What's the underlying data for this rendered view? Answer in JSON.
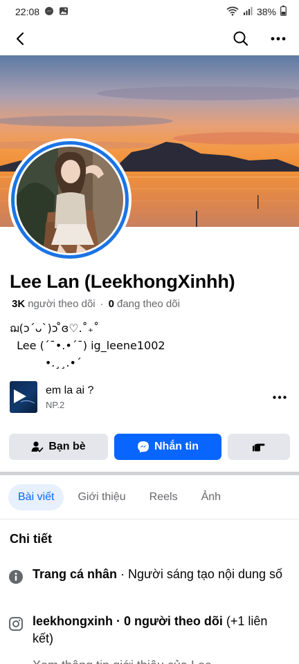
{
  "status": {
    "time": "22:08",
    "battery": "38%"
  },
  "profile": {
    "name": "Lee Lan (LeekhongXinhh)",
    "followers_count": "3K",
    "followers_label": "người theo dõi",
    "separator": "·",
    "following_count": "0",
    "following_label": "đang theo dõi"
  },
  "bio": {
    "line1": "ฌ(ɔ´ᴗ`)ɔ ̊ɞ♡.˚₊˚",
    "line2": "  Lee (´¯•.•´¯) ig_leene1002",
    "line3": "          •.¸¸.•´"
  },
  "music": {
    "title": "em la ai ?",
    "artist": "NP.2"
  },
  "actions": {
    "friends_label": "Bạn bè",
    "message_label": "Nhắn tin"
  },
  "tabs": [
    {
      "label": "Bài viết",
      "active": true
    },
    {
      "label": "Giới thiệu",
      "active": false
    },
    {
      "label": "Reels",
      "active": false
    },
    {
      "label": "Ảnh",
      "active": false
    }
  ],
  "details": {
    "title": "Chi tiết",
    "page_bold": "Trang cá nhân",
    "page_rest": " · Người sáng tạo nội dung số",
    "ig_bold": "leekhongxinh · 0 người theo dõi",
    "ig_rest": " (+1 liên kết)",
    "partial": "Xem thông tin giới thiệu của Lee"
  },
  "colors": {
    "brand_blue": "#0866ff",
    "avatar_ring": "#1b74e4",
    "secondary_text": "#65676b",
    "button_gray": "#e4e6eb"
  }
}
